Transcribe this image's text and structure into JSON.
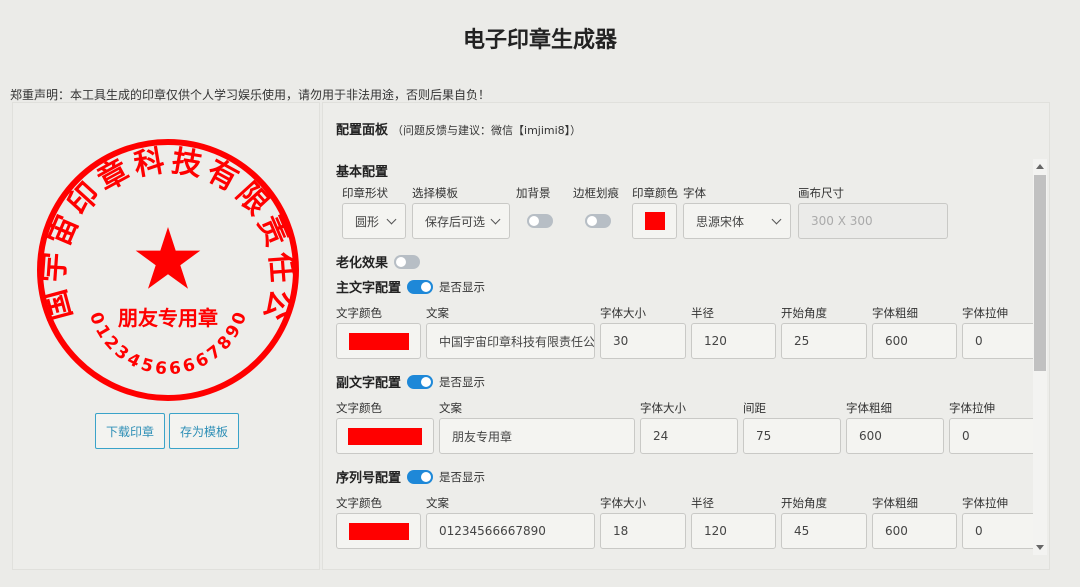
{
  "app": {
    "title": "电子印章生成器",
    "disclaimer": "郑重声明：本工具生成的印章仅供个人学习娱乐使用，请勿用于非法用途，否则后果自负！"
  },
  "stamp": {
    "main_text": "中国宇宙印章科技有限责任公司",
    "sub_text": "朋友专用章",
    "serial_text": "01234566667890",
    "color": "#ff0000",
    "center_icon": "star-icon"
  },
  "actions": {
    "download_label": "下载印章",
    "save_template_label": "存为模板"
  },
  "panel": {
    "title": "配置面板",
    "subtitle": "（问题反馈与建议：微信【imjimi8】）"
  },
  "basic": {
    "section_title": "基本配置",
    "shape_label": "印章形状",
    "shape_value": "圆形",
    "template_label": "选择模板",
    "template_value": "保存后可选",
    "background_label": "加背景",
    "border_label": "边框划痕",
    "color_label": "印章颜色",
    "font_label": "字体",
    "font_value": "思源宋体",
    "canvas_label": "画布尺寸",
    "canvas_placeholder": "300 X 300"
  },
  "aging": {
    "label": "老化效果"
  },
  "main_text_cfg": {
    "section_title": "主文字配置",
    "show_label": "是否显示",
    "color_label": "文字颜色",
    "text_label": "文案",
    "text_value": "中国宇宙印章科技有限责任公",
    "size_label": "字体大小",
    "size_value": "30",
    "radius_label": "半径",
    "radius_value": "120",
    "angle_label": "开始角度",
    "angle_value": "25",
    "weight_label": "字体粗细",
    "weight_value": "600",
    "stretch_label": "字体拉伸",
    "stretch_value": "0"
  },
  "sub_text_cfg": {
    "section_title": "副文字配置",
    "show_label": "是否显示",
    "color_label": "文字颜色",
    "text_label": "文案",
    "text_value": "朋友专用章",
    "size_label": "字体大小",
    "size_value": "24",
    "spacing_label": "间距",
    "spacing_value": "75",
    "weight_label": "字体粗细",
    "weight_value": "600",
    "stretch_label": "字体拉伸",
    "stretch_value": "0"
  },
  "serial_cfg": {
    "section_title": "序列号配置",
    "show_label": "是否显示",
    "color_label": "文字颜色",
    "text_label": "文案",
    "text_value": "01234566667890",
    "size_label": "字体大小",
    "size_value": "18",
    "radius_label": "半径",
    "radius_value": "120",
    "angle_label": "开始角度",
    "angle_value": "45",
    "weight_label": "字体粗细",
    "weight_value": "600",
    "stretch_label": "字体拉伸",
    "stretch_value": "0"
  }
}
